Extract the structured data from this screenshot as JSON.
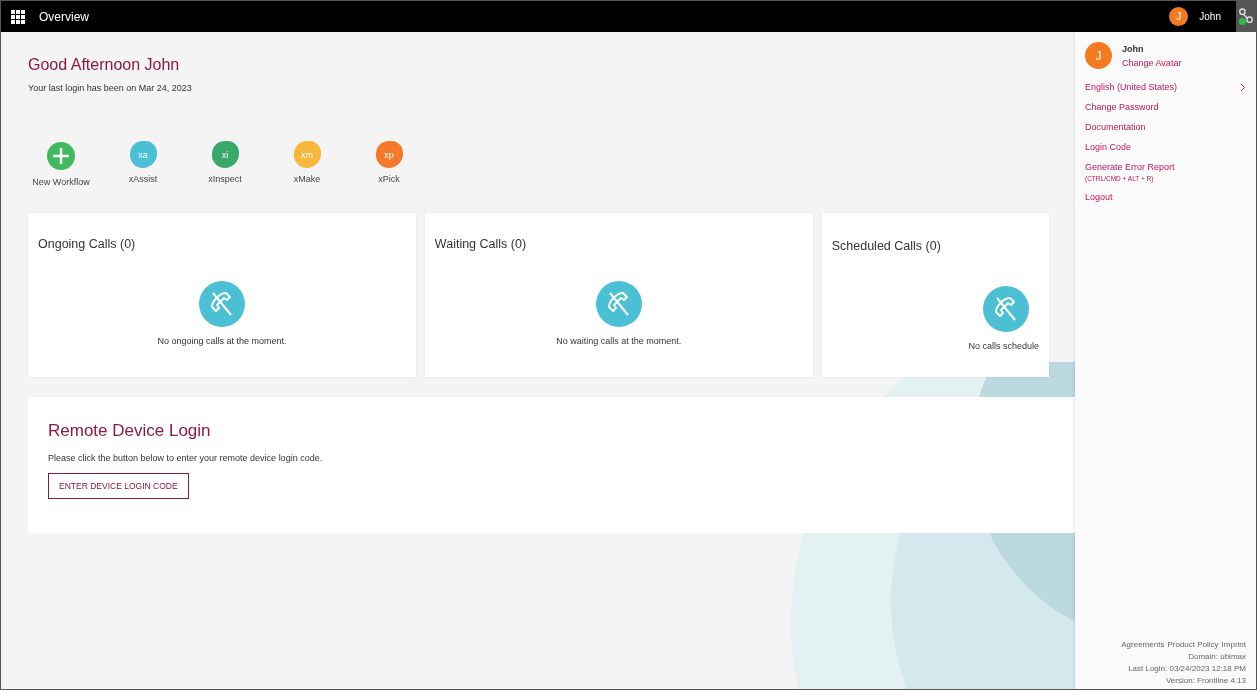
{
  "topbar": {
    "title": "Overview",
    "user_initial": "J",
    "user_name": "John"
  },
  "greeting": {
    "title": "Good Afternoon John",
    "subtitle": "Your last login has been on Mar 24, 2023"
  },
  "apps": [
    {
      "kind": "add",
      "label": "New Workflow"
    },
    {
      "kind": "app",
      "badge": "xa",
      "label": "xAssist",
      "color": "#4bbfd3"
    },
    {
      "kind": "app",
      "badge": "xi",
      "label": "xInspect",
      "color": "#3aa86a"
    },
    {
      "kind": "app",
      "badge": "xm",
      "label": "xMake",
      "color": "#f6b73c"
    },
    {
      "kind": "app",
      "badge": "xp",
      "label": "xPick",
      "color": "#f47a2a"
    }
  ],
  "call_cards": [
    {
      "title": "Ongoing Calls (0)",
      "message": "No ongoing calls at the moment."
    },
    {
      "title": "Waiting Calls (0)",
      "message": "No waiting calls at the moment."
    },
    {
      "title": "Scheduled Calls (0)",
      "message": "No calls schedule"
    }
  ],
  "remote_login": {
    "title": "Remote Device Login",
    "text": "Please click the button below to enter your remote device login code.",
    "button": "ENTER DEVICE LOGIN CODE"
  },
  "user_panel": {
    "initial": "J",
    "name": "John",
    "change_avatar": "Change Avatar",
    "menu": [
      {
        "label": "English (United States)",
        "submenu": true
      },
      {
        "label": "Change Password",
        "submenu": false
      },
      {
        "label": "Documentation",
        "submenu": false
      },
      {
        "label": "Login Code",
        "submenu": false
      },
      {
        "label": "Generate Error Report",
        "hint": "(CTRL/CMD + ALT + R)",
        "submenu": false
      },
      {
        "label": "Logout",
        "submenu": false
      }
    ],
    "footer_links": [
      "Agreements",
      "Product Policy",
      "Imprint"
    ],
    "footer_lines": [
      "Domain: ubimax",
      "Last Login: 03/24/2023 12:18 PM",
      "Version: Frontline 4.13"
    ]
  }
}
